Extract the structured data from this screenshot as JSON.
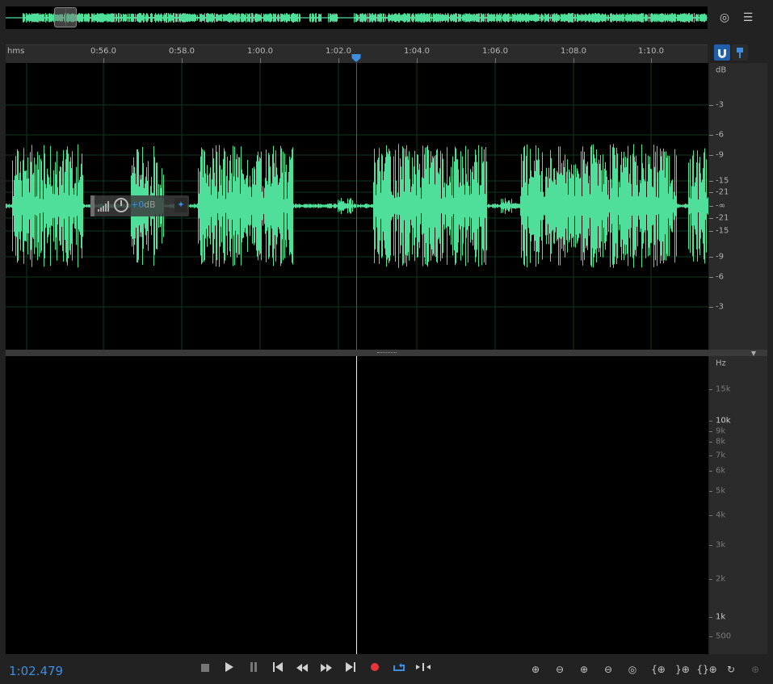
{
  "timeline": {
    "unit_label": "hms",
    "ticks": [
      "0:56.0",
      "0:58.0",
      "1:00.0",
      "1:02.0",
      "1:04.0",
      "1:06.0",
      "1:08.0",
      "1:10.0"
    ]
  },
  "amplitude_scale": {
    "unit": "dB",
    "labels": [
      "-3",
      "-6",
      "-9",
      "-15",
      "-21",
      "-∞",
      "-21",
      "-15",
      "-9",
      "-6",
      "-3"
    ]
  },
  "hud": {
    "value": "+0",
    "unit": "dB"
  },
  "frequency_scale": {
    "unit": "Hz",
    "labels": [
      "15k",
      "10k",
      "9k",
      "8k",
      "7k",
      "6k",
      "5k",
      "4k",
      "3k",
      "2k",
      "1k",
      "500"
    ]
  },
  "transport": {
    "timecode": "1:02.479",
    "buttons": [
      "stop",
      "play",
      "pause",
      "previous",
      "rewind",
      "fast-forward",
      "next",
      "record",
      "loop",
      "skip-selection"
    ]
  },
  "zoom_tools": [
    "zoom-in-amplitude",
    "zoom-out-amplitude",
    "zoom-in-time",
    "zoom-out-time",
    "zoom-out-full",
    "zoom-in-selection",
    "zoom-to-selection-left",
    "zoom-to-selection-right",
    "zoom-reset",
    "zoom-disabled"
  ],
  "colors": {
    "waveform": "#4fdf9a",
    "playhead": "#cc2a2a",
    "timecode": "#3d8ee0",
    "accent": "#3d8ee0",
    "record": "#e83535"
  }
}
